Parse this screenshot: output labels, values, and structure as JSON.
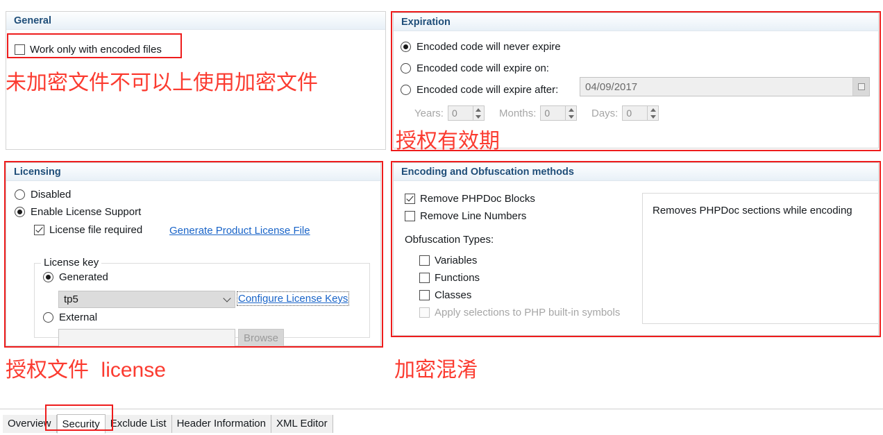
{
  "panels": {
    "general": {
      "title": "General",
      "work_only_encoded": {
        "label": "Work only with encoded files",
        "checked": false
      },
      "annotation": "未加密文件不可以上使用加密文件"
    },
    "expiration": {
      "title": "Expiration",
      "options": [
        {
          "label": "Encoded code will never expire",
          "selected": true
        },
        {
          "label": "Encoded code will expire on:",
          "selected": false
        },
        {
          "label": "Encoded code will expire after:",
          "selected": false
        }
      ],
      "expire_date": "04/09/2017",
      "duration": [
        {
          "label": "Years:",
          "value": "0"
        },
        {
          "label": "Months:",
          "value": "0"
        },
        {
          "label": "Days:",
          "value": "0"
        }
      ],
      "annotation": "授权有效期"
    },
    "licensing": {
      "title": "Licensing",
      "mode_disabled": {
        "label": "Disabled",
        "selected": false
      },
      "mode_enabled": {
        "label": "Enable License Support",
        "selected": true
      },
      "license_file_required": {
        "label": "License file required",
        "checked": true
      },
      "generate_link": "Generate Product License File",
      "groupbox_legend": "License key",
      "generated": {
        "label": "Generated",
        "selected": true
      },
      "key_value": "tp5",
      "configure_link": "Configure License Keys",
      "external": {
        "label": "External",
        "selected": false
      },
      "external_path": "",
      "browse_label": "Browse",
      "annotation_cn": "授权文件",
      "annotation_en": "license"
    },
    "encoding": {
      "title": "Encoding and Obfuscation methods",
      "remove_phpdoc": {
        "label": "Remove PHPDoc Blocks",
        "checked": true
      },
      "remove_line_numbers": {
        "label": "Remove Line Numbers",
        "checked": false
      },
      "obfuscation_heading": "Obfuscation Types:",
      "types": [
        {
          "label": "Variables",
          "checked": false,
          "disabled": false
        },
        {
          "label": "Functions",
          "checked": false,
          "disabled": false
        },
        {
          "label": "Classes",
          "checked": false,
          "disabled": false
        },
        {
          "label": "Apply selections to PHP built-in symbols",
          "checked": false,
          "disabled": true
        }
      ],
      "description": "Removes PHPDoc sections while encoding",
      "annotation": "加密混淆"
    }
  },
  "tabs": [
    {
      "label": "Overview",
      "active": false
    },
    {
      "label": "Security",
      "active": true
    },
    {
      "label": "Exclude List",
      "active": false
    },
    {
      "label": "Header Information",
      "active": false
    },
    {
      "label": "XML Editor",
      "active": false
    }
  ],
  "colors": {
    "annotation_red": "#fb3b30",
    "box_red": "#ee1c1c",
    "header_blue": "#1f4e79",
    "link_blue": "#1964c8"
  }
}
